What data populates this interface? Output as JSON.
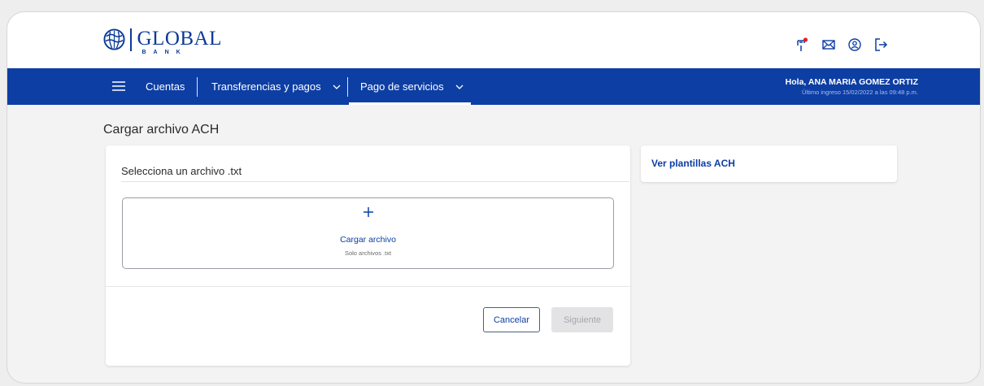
{
  "brand": {
    "name": "GLOBAL",
    "sub": "BANK",
    "primary_color": "#0d3ea3"
  },
  "top_icons": [
    "flag-icon",
    "mail-icon",
    "user-circle-icon",
    "logout-icon"
  ],
  "nav": {
    "items": [
      {
        "label": "Cuentas"
      },
      {
        "label": "Transferencias y pagos"
      },
      {
        "label": "Pago de servicios"
      }
    ],
    "active": "Pago de servicios",
    "greeting": "Hola, ANA MARIA GOMEZ ORTIZ",
    "last_login": "Último ingreso 15/02/2022 a las 09:48 p.m."
  },
  "page": {
    "title": "Cargar archivo ACH"
  },
  "upload_card": {
    "label": "Selecciona un archivo .txt",
    "upload_action": "Cargar archivo",
    "hint": "Solo archivos .txt",
    "cancel_label": "Cancelar",
    "next_label": "Siguiente",
    "next_disabled": true
  },
  "side_card": {
    "link_label": "Ver plantillas ACH"
  }
}
